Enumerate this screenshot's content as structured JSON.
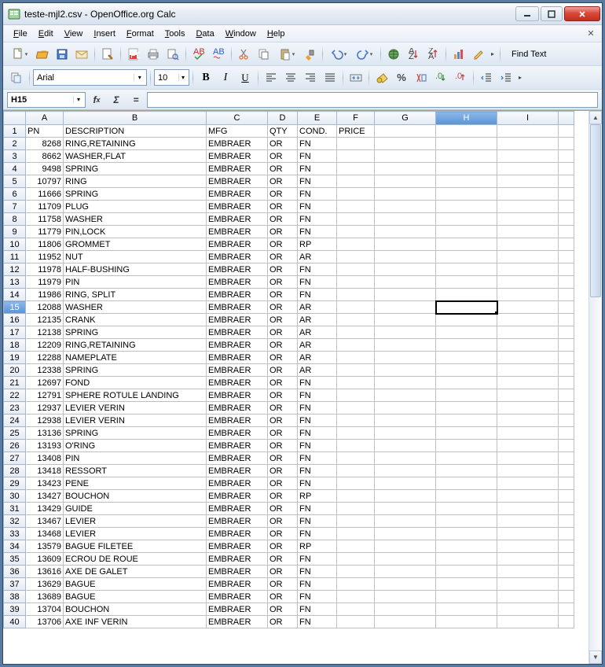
{
  "window": {
    "title": "teste-mjl2.csv - OpenOffice.org Calc"
  },
  "menus": [
    "File",
    "Edit",
    "View",
    "Insert",
    "Format",
    "Tools",
    "Data",
    "Window",
    "Help"
  ],
  "find": {
    "label": "Find Text"
  },
  "format": {
    "font_name": "Arial",
    "font_size": "10"
  },
  "namebox": {
    "ref": "H15"
  },
  "formula": {
    "value": ""
  },
  "selected": {
    "col": "H",
    "row": 15
  },
  "columns": [
    "A",
    "B",
    "C",
    "D",
    "E",
    "F",
    "G",
    "H",
    "I",
    ""
  ],
  "chart_data": {
    "type": "table",
    "headers": [
      "PN",
      "DESCRIPTION",
      "MFG",
      "QTY",
      "COND.",
      "PRICE"
    ],
    "rows": [
      [
        "8268",
        "RING,RETAINING",
        "EMBRAER",
        "OR",
        "FN",
        ""
      ],
      [
        "8662",
        "WASHER,FLAT",
        "EMBRAER",
        "OR",
        "FN",
        ""
      ],
      [
        "9498",
        "SPRING",
        "EMBRAER",
        "OR",
        "FN",
        ""
      ],
      [
        "10797",
        "RING",
        "EMBRAER",
        "OR",
        "FN",
        ""
      ],
      [
        "11666",
        "SPRING",
        "EMBRAER",
        "OR",
        "FN",
        ""
      ],
      [
        "11709",
        "PLUG",
        "EMBRAER",
        "OR",
        "FN",
        ""
      ],
      [
        "11758",
        "WASHER",
        "EMBRAER",
        "OR",
        "FN",
        ""
      ],
      [
        "11779",
        "PIN,LOCK",
        "EMBRAER",
        "OR",
        "FN",
        ""
      ],
      [
        "11806",
        "GROMMET",
        "EMBRAER",
        "OR",
        "RP",
        ""
      ],
      [
        "11952",
        "NUT",
        "EMBRAER",
        "OR",
        "AR",
        ""
      ],
      [
        "11978",
        "HALF-BUSHING",
        "EMBRAER",
        "OR",
        "FN",
        ""
      ],
      [
        "11979",
        "PIN",
        "EMBRAER",
        "OR",
        "FN",
        ""
      ],
      [
        "11986",
        "RING, SPLIT",
        "EMBRAER",
        "OR",
        "FN",
        ""
      ],
      [
        "12088",
        "WASHER",
        "EMBRAER",
        "OR",
        "AR",
        ""
      ],
      [
        "12135",
        "CRANK",
        "EMBRAER",
        "OR",
        "AR",
        ""
      ],
      [
        "12138",
        "SPRING",
        "EMBRAER",
        "OR",
        "AR",
        ""
      ],
      [
        "12209",
        "RING,RETAINING",
        "EMBRAER",
        "OR",
        "AR",
        ""
      ],
      [
        "12288",
        "NAMEPLATE",
        "EMBRAER",
        "OR",
        "AR",
        ""
      ],
      [
        "12338",
        "SPRING",
        "EMBRAER",
        "OR",
        "AR",
        ""
      ],
      [
        "12697",
        "FOND",
        "EMBRAER",
        "OR",
        "FN",
        ""
      ],
      [
        "12791",
        "SPHERE ROTULE LANDING",
        "EMBRAER",
        "OR",
        "FN",
        ""
      ],
      [
        "12937",
        "LEVIER VERIN",
        "EMBRAER",
        "OR",
        "FN",
        ""
      ],
      [
        "12938",
        "LEVIER VERIN",
        "EMBRAER",
        "OR",
        "FN",
        ""
      ],
      [
        "13136",
        "SPRING",
        "EMBRAER",
        "OR",
        "FN",
        ""
      ],
      [
        "13193",
        "O'RING",
        "EMBRAER",
        "OR",
        "FN",
        ""
      ],
      [
        "13408",
        "PIN",
        "EMBRAER",
        "OR",
        "FN",
        ""
      ],
      [
        "13418",
        "RESSORT",
        "EMBRAER",
        "OR",
        "FN",
        ""
      ],
      [
        "13423",
        "PENE",
        "EMBRAER",
        "OR",
        "FN",
        ""
      ],
      [
        "13427",
        "BOUCHON",
        "EMBRAER",
        "OR",
        "RP",
        ""
      ],
      [
        "13429",
        "GUIDE",
        "EMBRAER",
        "OR",
        "FN",
        ""
      ],
      [
        "13467",
        "LEVIER",
        "EMBRAER",
        "OR",
        "FN",
        ""
      ],
      [
        "13468",
        "LEVIER",
        "EMBRAER",
        "OR",
        "FN",
        ""
      ],
      [
        "13579",
        "BAGUE FILETEE",
        "EMBRAER",
        "OR",
        "RP",
        ""
      ],
      [
        "13609",
        "ECROU DE ROUE",
        "EMBRAER",
        "OR",
        "FN",
        ""
      ],
      [
        "13616",
        "AXE DE GALET",
        "EMBRAER",
        "OR",
        "FN",
        ""
      ],
      [
        "13629",
        "BAGUE",
        "EMBRAER",
        "OR",
        "FN",
        ""
      ],
      [
        "13689",
        "BAGUE",
        "EMBRAER",
        "OR",
        "FN",
        ""
      ],
      [
        "13704",
        "BOUCHON",
        "EMBRAER",
        "OR",
        "FN",
        ""
      ],
      [
        "13706",
        "AXE INF VERIN",
        "EMBRAER",
        "OR",
        "FN",
        ""
      ]
    ]
  }
}
